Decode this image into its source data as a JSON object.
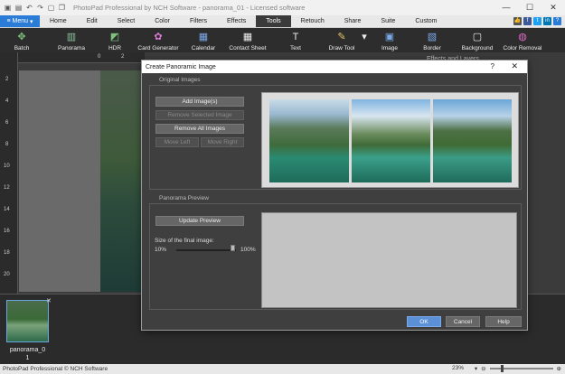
{
  "window": {
    "title": "PhotoPad Professional by NCH Software - panorama_01 - Licensed software",
    "minimize": "—",
    "maximize": "☐",
    "close": "✕"
  },
  "menubar": {
    "menu_label": "Menu",
    "tabs": [
      "Home",
      "Edit",
      "Select",
      "Color",
      "Filters",
      "Effects",
      "Tools",
      "Retouch",
      "Share",
      "Suite",
      "Custom"
    ],
    "active_tab": "Tools"
  },
  "toolbar": {
    "tools": [
      {
        "label": "Batch",
        "icon": "batch-icon"
      },
      {
        "label": "Panorama",
        "icon": "panorama-icon"
      },
      {
        "label": "HDR",
        "icon": "hdr-icon"
      },
      {
        "label": "Card Generator",
        "icon": "card-generator-icon"
      },
      {
        "label": "Calendar",
        "icon": "calendar-icon"
      },
      {
        "label": "Contact Sheet",
        "icon": "contact-sheet-icon"
      },
      {
        "label": "Text",
        "icon": "text-icon"
      },
      {
        "label": "Draw Tool",
        "icon": "draw-tool-icon"
      },
      {
        "label": "Image",
        "icon": "image-icon"
      },
      {
        "label": "Border",
        "icon": "border-icon"
      },
      {
        "label": "Background",
        "icon": "background-icon"
      },
      {
        "label": "Color Removal",
        "icon": "color-removal-icon"
      }
    ]
  },
  "ruler": {
    "left": [
      "2",
      "4",
      "6",
      "8",
      "10",
      "12",
      "14",
      "16",
      "18",
      "20"
    ],
    "top": [
      "0",
      "2"
    ]
  },
  "right_panel": {
    "header": "Effects and Layers"
  },
  "dialog": {
    "title": "Create Panoramic Image",
    "help": "?",
    "close": "✕",
    "original_images": {
      "title": "Original Images",
      "add": "Add Image(s)",
      "remove_selected": "Remove Selected Image",
      "remove_all": "Remove All Images",
      "move_left": "Move Left",
      "move_right": "Move Right"
    },
    "panorama_preview": {
      "title": "Panorama Preview",
      "update": "Update Preview",
      "size_label": "Size of the final image:",
      "size_min": "10%",
      "size_max": "100%",
      "size_value_percent": 100
    },
    "ok": "OK",
    "cancel": "Cancel",
    "help_button": "Help"
  },
  "filmstrip": {
    "thumb_label": "panorama_0\n1",
    "thumb_close": "✕"
  },
  "statusbar": {
    "left": "PhotoPad Professional © NCH Software",
    "zoom": "23%"
  }
}
